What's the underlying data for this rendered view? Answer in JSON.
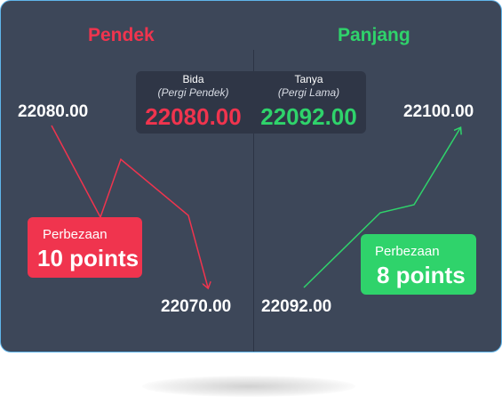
{
  "short": {
    "heading": "Pendek",
    "start_price": "22080.00",
    "end_price": "22070.00",
    "diff_label": "Perbezaan",
    "diff_value": "10 points"
  },
  "long": {
    "heading": "Panjang",
    "start_price": "22092.00",
    "end_price": "22100.00",
    "diff_label": "Perbezaan",
    "diff_value": "8 points"
  },
  "quote": {
    "bid_label": "Bida",
    "bid_sub": "(Pergi Pendek)",
    "bid_price": "22080.00",
    "ask_label": "Tanya",
    "ask_sub": "(Pergi Lama)",
    "ask_price": "22092.00"
  },
  "colors": {
    "short": "#f0344e",
    "long": "#2fd36b",
    "card": "#3d4759",
    "quote_panel": "#2f3646"
  }
}
